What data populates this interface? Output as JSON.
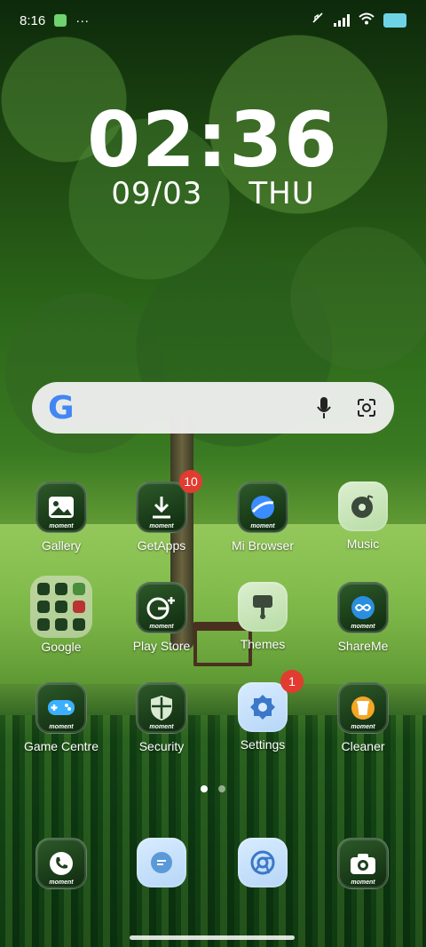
{
  "status_bar": {
    "time": "8:16",
    "more": "···"
  },
  "clock": {
    "time": "02:36",
    "date": "09/03",
    "day": "THU"
  },
  "search_bar": {
    "logo": "G"
  },
  "apps": {
    "row1": [
      {
        "label": "Gallery",
        "icon": "gallery-icon"
      },
      {
        "label": "GetApps",
        "icon": "download-icon",
        "badge": "10"
      },
      {
        "label": "Mi Browser",
        "icon": "browser-icon"
      },
      {
        "label": "Music",
        "icon": "music-icon"
      }
    ],
    "row2": [
      {
        "label": "Google",
        "icon": "folder-icon"
      },
      {
        "label": "Play Store",
        "icon": "google-plus-icon"
      },
      {
        "label": "Themes",
        "icon": "brush-icon"
      },
      {
        "label": "ShareMe",
        "icon": "infinity-icon"
      }
    ],
    "row3": [
      {
        "label": "Game Centre",
        "icon": "gamepad-icon"
      },
      {
        "label": "Security",
        "icon": "shield-icon"
      },
      {
        "label": "Settings",
        "icon": "gear-icon",
        "badge": "1"
      },
      {
        "label": "Cleaner",
        "icon": "trash-icon"
      }
    ]
  },
  "dock": [
    {
      "icon": "phone-icon"
    },
    {
      "icon": "message-icon"
    },
    {
      "icon": "chrome-icon"
    },
    {
      "icon": "camera-icon"
    }
  ],
  "moment_tag": "moment",
  "pages": {
    "count": 2,
    "active": 0
  }
}
